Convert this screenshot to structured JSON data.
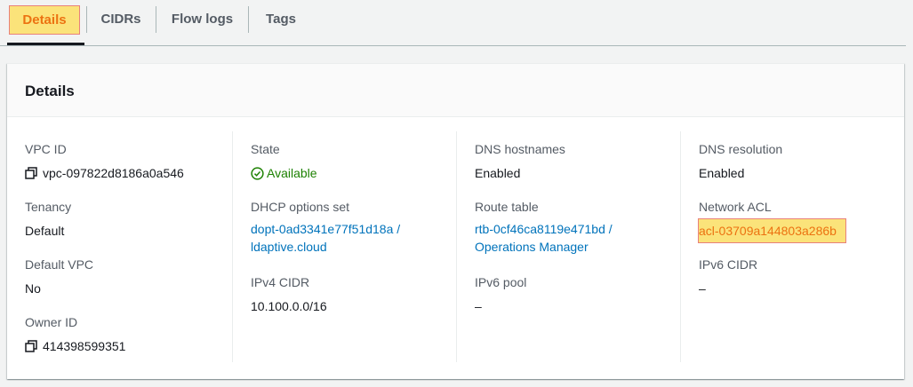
{
  "tabs": [
    {
      "label": "Details"
    },
    {
      "label": "CIDRs"
    },
    {
      "label": "Flow logs"
    },
    {
      "label": "Tags"
    }
  ],
  "panel": {
    "title": "Details",
    "col1": {
      "vpc_id_label": "VPC ID",
      "vpc_id_value": "vpc-097822d8186a0a546",
      "tenancy_label": "Tenancy",
      "tenancy_value": "Default",
      "default_vpc_label": "Default VPC",
      "default_vpc_value": "No",
      "owner_id_label": "Owner ID",
      "owner_id_value": "414398599351"
    },
    "col2": {
      "state_label": "State",
      "state_value": "Available",
      "dhcp_label": "DHCP options set",
      "dhcp_value_line1": "dopt-0ad3341e77f51d18a /",
      "dhcp_value_line2": "ldaptive.cloud",
      "ipv4_label": "IPv4 CIDR",
      "ipv4_value": "10.100.0.0/16"
    },
    "col3": {
      "dns_hostnames_label": "DNS hostnames",
      "dns_hostnames_value": "Enabled",
      "route_table_label": "Route table",
      "route_table_line1": "rtb-0cf46ca8119e471bd /",
      "route_table_line2": "Operations Manager",
      "ipv6_pool_label": "IPv6 pool",
      "ipv6_pool_value": "–"
    },
    "col4": {
      "dns_resolution_label": "DNS resolution",
      "dns_resolution_value": "Enabled",
      "nacl_label": "Network ACL",
      "nacl_value": "acl-03709a144803a286b",
      "ipv6_cidr_label": "IPv6 CIDR",
      "ipv6_cidr_value": "–"
    }
  },
  "colors": {
    "link": "#0073bb",
    "status_ok": "#1d8102",
    "highlight_fill": "#fbe37a",
    "highlight_border": "#e8817a",
    "active_orange": "#ec7211"
  }
}
